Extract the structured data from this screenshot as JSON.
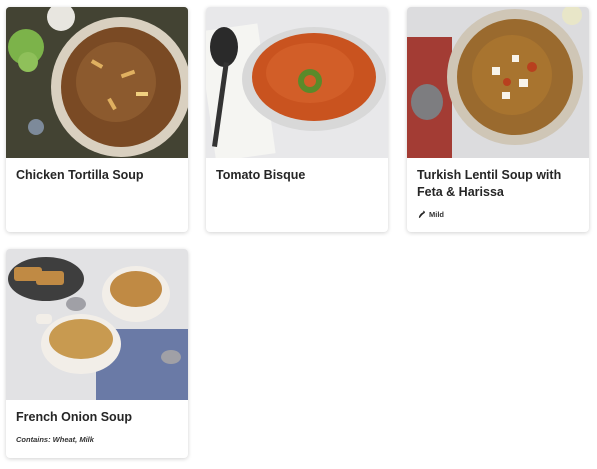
{
  "menu_items": [
    {
      "title": "Chicken Tortilla Soup",
      "tag": ""
    },
    {
      "title": "Tomato Bisque",
      "tag": ""
    },
    {
      "title": "Turkish Lentil Soup with Feta & Harissa",
      "tag": "Mild",
      "tag_icon": "pepper-icon"
    },
    {
      "title": "French Onion Soup",
      "tag": "Contains: Wheat, Milk"
    }
  ]
}
